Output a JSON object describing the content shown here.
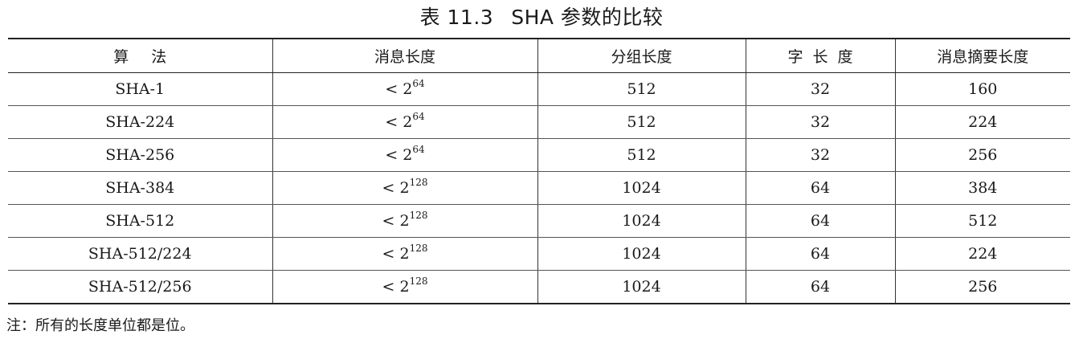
{
  "caption": {
    "number": "表 11.3",
    "title": "SHA 参数的比较"
  },
  "table": {
    "headers": [
      "算法",
      "消息长度",
      "分组长度",
      "字长度",
      "消息摘要长度"
    ],
    "rows": [
      {
        "algorithm": "SHA-1",
        "msg_prefix": "< 2",
        "msg_exp": "64",
        "block": "512",
        "word": "32",
        "digest": "160"
      },
      {
        "algorithm": "SHA-224",
        "msg_prefix": "< 2",
        "msg_exp": "64",
        "block": "512",
        "word": "32",
        "digest": "224"
      },
      {
        "algorithm": "SHA-256",
        "msg_prefix": "< 2",
        "msg_exp": "64",
        "block": "512",
        "word": "32",
        "digest": "256"
      },
      {
        "algorithm": "SHA-384",
        "msg_prefix": "< 2",
        "msg_exp": "128",
        "block": "1024",
        "word": "64",
        "digest": "384"
      },
      {
        "algorithm": "SHA-512",
        "msg_prefix": "< 2",
        "msg_exp": "128",
        "block": "1024",
        "word": "64",
        "digest": "512"
      },
      {
        "algorithm": "SHA-512/224",
        "msg_prefix": "< 2",
        "msg_exp": "128",
        "block": "1024",
        "word": "64",
        "digest": "224"
      },
      {
        "algorithm": "SHA-512/256",
        "msg_prefix": "< 2",
        "msg_exp": "128",
        "block": "1024",
        "word": "64",
        "digest": "256"
      }
    ]
  },
  "note": "注：所有的长度单位都是位。"
}
